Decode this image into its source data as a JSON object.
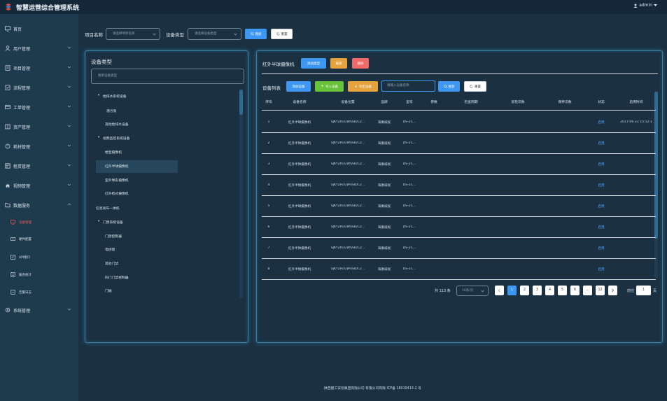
{
  "app": {
    "title": "智慧运营综合管理系统",
    "user": "admin"
  },
  "sidebar": {
    "items": [
      {
        "label": "首页",
        "icon": "monitor-icon"
      },
      {
        "label": "用户管理",
        "icon": "user-icon"
      },
      {
        "label": "项目管理",
        "icon": "project-icon"
      },
      {
        "label": "流程管理",
        "icon": "flow-icon"
      },
      {
        "label": "工单管理",
        "icon": "ticket-icon"
      },
      {
        "label": "资产管理",
        "icon": "asset-icon"
      },
      {
        "label": "耗材管理",
        "icon": "supplies-icon"
      },
      {
        "label": "租赁管理",
        "icon": "lease-icon"
      },
      {
        "label": "视频管理",
        "icon": "video-icon"
      },
      {
        "label": "数据服务",
        "icon": "folder-icon"
      }
    ],
    "sub_items": [
      {
        "label": "设备管理",
        "icon": "device-icon",
        "active": true
      },
      {
        "label": "硬件配置",
        "icon": "hardware-icon"
      },
      {
        "label": "API接口",
        "icon": "api-icon"
      },
      {
        "label": "服务统计",
        "icon": "stats-icon"
      },
      {
        "label": "告警日志",
        "icon": "log-icon"
      }
    ],
    "last_item": {
      "label": "系统管理",
      "icon": "settings-icon"
    }
  },
  "filters": {
    "project_label": "项目名称",
    "project_placeholder": "请选择项目名称",
    "type_label": "设备类型",
    "type_placeholder": "请选择设备类型",
    "search_label": "搜索",
    "reset_label": "重置"
  },
  "tree": {
    "title": "设备类型",
    "search_placeholder": "搜索设备类型",
    "nodes": [
      {
        "label": "给排水系统设备",
        "expanded": true
      },
      {
        "label": "潜污泵"
      },
      {
        "label": "其他给排水设备"
      },
      {
        "label": "视频监控系统设备",
        "expanded": true
      },
      {
        "label": "枪型摄像机"
      },
      {
        "label": "红外半球摄像机",
        "selected": true
      },
      {
        "label": "室外球形摄像机"
      },
      {
        "label": "红外枪式摄像机"
      },
      {
        "label": "信息发布一体机"
      },
      {
        "label": "门禁系统设备",
        "expanded": true
      },
      {
        "label": "门禁控制器"
      },
      {
        "label": "电控锁"
      },
      {
        "label": "其他门禁"
      },
      {
        "label": "四门门禁控制器"
      },
      {
        "label": "门磁"
      }
    ]
  },
  "device": {
    "current_type": "红外半球摄像机",
    "add_type_label": "添加类型",
    "edit_label": "编辑",
    "delete_label": "删除",
    "list_title": "设备列表",
    "add_device_label": "添加设备",
    "import_label": "导入设备",
    "export_label": "导出设备",
    "search_placeholder": "请输入设备名称",
    "search_label": "搜索",
    "reset_label": "重置"
  },
  "table": {
    "headers": [
      "序号",
      "设备名称",
      "设备位置",
      "品牌",
      "型号",
      "参数",
      "检查周期",
      "巡检次数",
      "保养次数",
      "状态",
      "启用时间"
    ],
    "rows": [
      [
        "1",
        "红外半球摄像机",
        "SJKYZHLGWSSIDC2...",
        "海康威视",
        "DS-2C...",
        "",
        "",
        "",
        "",
        "启用",
        "2017-06-22 15:12:1"
      ],
      [
        "2",
        "红外半球摄像机",
        "SJKYZHLGWSSIDC2...",
        "海康威视",
        "DS-2C...",
        "",
        "",
        "",
        "",
        "启用",
        ""
      ],
      [
        "3",
        "红外半球摄像机",
        "SJKYZHLGWSSIDC2...",
        "海康威视",
        "DS-2C...",
        "",
        "",
        "",
        "",
        "启用",
        ""
      ],
      [
        "4",
        "红外半球摄像机",
        "SJKYZHLGWSSIDC2...",
        "海康威视",
        "DS-2C...",
        "",
        "",
        "",
        "",
        "启用",
        ""
      ],
      [
        "5",
        "红外半球摄像机",
        "SJKYZHLGWSSIDC2...",
        "海康威视",
        "DS-2C...",
        "",
        "",
        "",
        "",
        "启用",
        ""
      ],
      [
        "6",
        "红外半球摄像机",
        "SJKYZHLGWSSIDC2...",
        "海康威视",
        "DS-2C...",
        "",
        "",
        "",
        "",
        "启用",
        ""
      ],
      [
        "7",
        "红外半球摄像机",
        "SJKYZHLGWSSIDC2...",
        "海康威视",
        "DS-2C...",
        "",
        "",
        "",
        "",
        "启用",
        ""
      ],
      [
        "8",
        "红外半球摄像机",
        "SJKYZHLGWSSIDC2...",
        "海康威视",
        "DS-2C...",
        "",
        "",
        "",
        "",
        "启用",
        ""
      ]
    ]
  },
  "pagination": {
    "total": "共 113 条",
    "page_size": "10条/页",
    "pages": [
      "1",
      "2",
      "3",
      "4",
      "5",
      "6",
      "...",
      "12"
    ],
    "current_page": "1",
    "goto_prefix": "前往",
    "goto_value": "1",
    "goto_suffix": "页"
  },
  "footer": {
    "text": "陕西建工安装集团有限公司 有限公司有限 ICP备 18019413-2 号"
  },
  "colors": {
    "accent": "#3e97f2",
    "orange": "#e6a23c",
    "red": "#f06a6a",
    "green": "#67c23a",
    "active_menu": "#e85d5d",
    "panel_glow": "#3b7ea6"
  }
}
